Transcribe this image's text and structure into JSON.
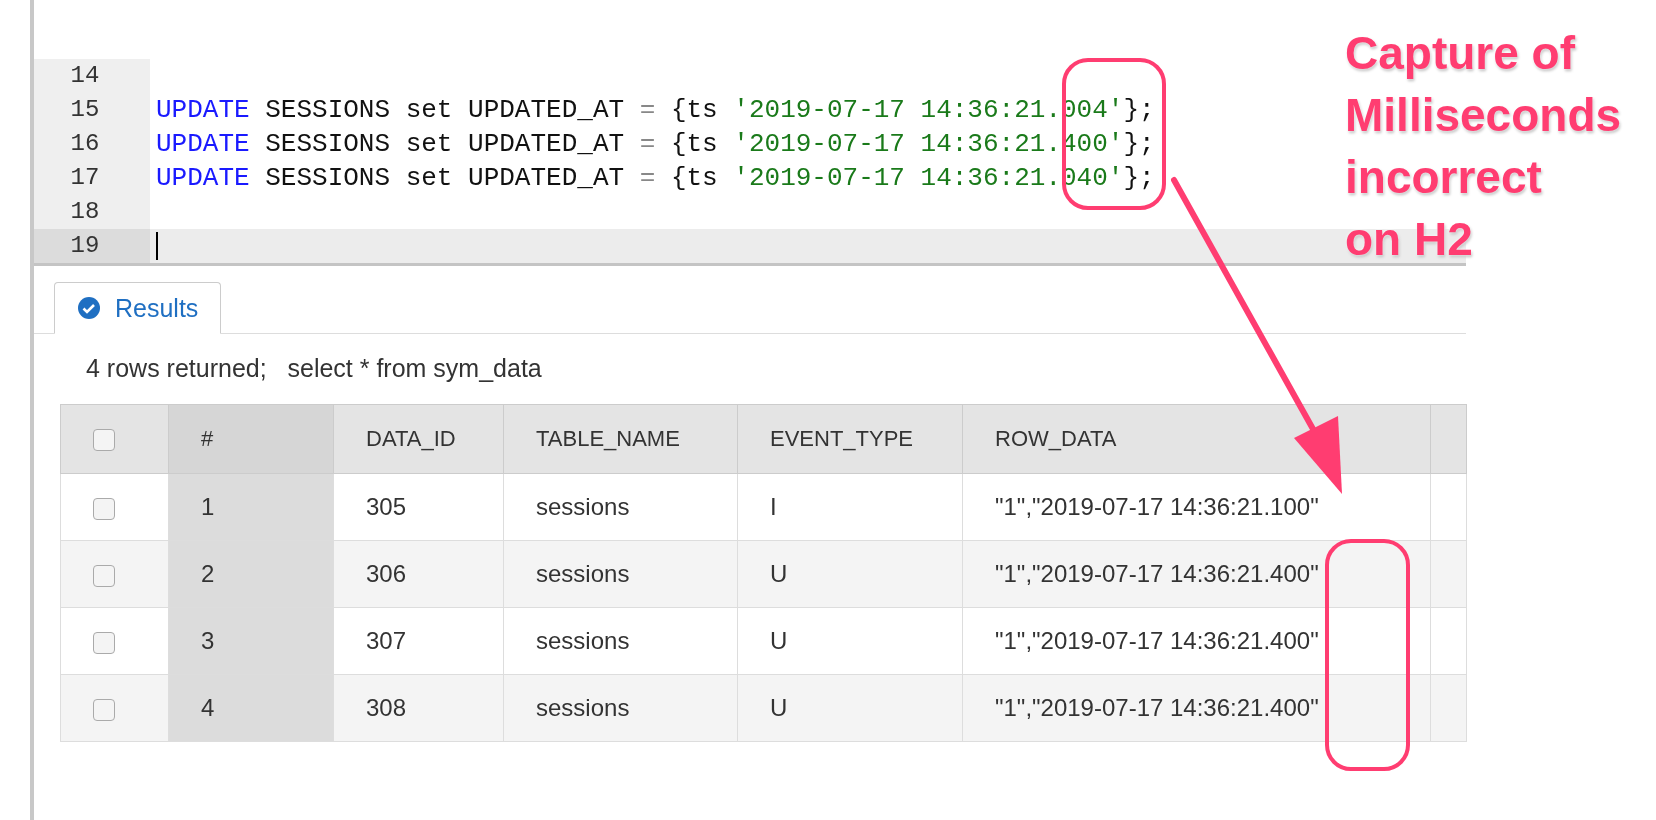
{
  "editor": {
    "lines": [
      {
        "number": "14",
        "current": false
      },
      {
        "number": "15",
        "current": false,
        "tokens": [
          {
            "kind": "keyword",
            "text": "UPDATE"
          },
          {
            "kind": "plain",
            "text": " SESSIONS set UPDATED_AT "
          },
          {
            "kind": "operator",
            "text": "="
          },
          {
            "kind": "plain",
            "text": " {ts "
          },
          {
            "kind": "string",
            "text": "'2019-07-17 14:36:21.004'"
          },
          {
            "kind": "plain",
            "text": "};"
          }
        ]
      },
      {
        "number": "16",
        "current": false,
        "tokens": [
          {
            "kind": "keyword",
            "text": "UPDATE"
          },
          {
            "kind": "plain",
            "text": " SESSIONS set UPDATED_AT "
          },
          {
            "kind": "operator",
            "text": "="
          },
          {
            "kind": "plain",
            "text": " {ts "
          },
          {
            "kind": "string",
            "text": "'2019-07-17 14:36:21.400'"
          },
          {
            "kind": "plain",
            "text": "};"
          }
        ]
      },
      {
        "number": "17",
        "current": false,
        "tokens": [
          {
            "kind": "keyword",
            "text": "UPDATE"
          },
          {
            "kind": "plain",
            "text": " SESSIONS set UPDATED_AT "
          },
          {
            "kind": "operator",
            "text": "="
          },
          {
            "kind": "plain",
            "text": " {ts "
          },
          {
            "kind": "string",
            "text": "'2019-07-17 14:36:21.040'"
          },
          {
            "kind": "plain",
            "text": "};"
          }
        ]
      },
      {
        "number": "18",
        "current": false
      },
      {
        "number": "19",
        "current": true
      }
    ]
  },
  "results": {
    "tabs": [
      {
        "label": "Results",
        "selected": true
      }
    ],
    "summary": "4 rows returned;   select * from sym_data",
    "table": {
      "header_checked": false,
      "columns": [
        "#",
        "DATA_ID",
        "TABLE_NAME",
        "EVENT_TYPE",
        "ROW_DATA"
      ],
      "rows": [
        {
          "checked": false,
          "cells": [
            "1",
            "305",
            "sessions",
            "I",
            "\"1\",\"2019-07-17 14:36:21.100\""
          ]
        },
        {
          "checked": false,
          "cells": [
            "2",
            "306",
            "sessions",
            "U",
            "\"1\",\"2019-07-17 14:36:21.400\""
          ]
        },
        {
          "checked": false,
          "cells": [
            "3",
            "307",
            "sessions",
            "U",
            "\"1\",\"2019-07-17 14:36:21.400\""
          ]
        },
        {
          "checked": false,
          "cells": [
            "4",
            "308",
            "sessions",
            "U",
            "\"1\",\"2019-07-17 14:36:21.400\""
          ]
        }
      ]
    }
  },
  "annotation": {
    "callout": [
      "Capture of",
      "Milliseconds",
      "incorrect",
      "on H2"
    ]
  }
}
